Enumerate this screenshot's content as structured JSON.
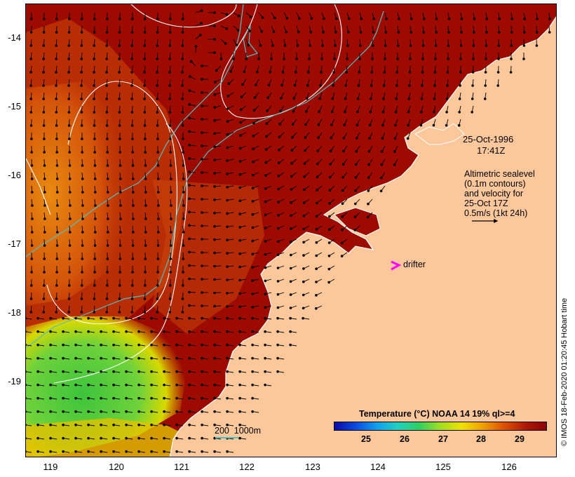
{
  "map": {
    "y_labels": [
      "-14",
      "-15",
      "-16",
      "-17",
      "-18",
      "-19"
    ],
    "x_labels": [
      "119",
      "120",
      "121",
      "122",
      "123",
      "124",
      "125",
      "126"
    ],
    "lon_range": [
      118.62,
      126.75
    ],
    "lat_range": [
      -13.52,
      -20.05
    ]
  },
  "annotations": {
    "date": "25-Oct-1996",
    "time": "17:41Z",
    "altimetry_lines": [
      "Altimetric sealevel",
      "(0.1m contours)",
      "and velocity for",
      "25-Oct 17Z"
    ],
    "velocity_scale": "0.5m/s (1kt 24h)",
    "drifter_label": "drifter",
    "depth_legend": "200  1000m"
  },
  "colorbar": {
    "title": "Temperature (°C) NOAA 14 19% ql>=4",
    "labels": [
      "25",
      "26",
      "27",
      "28",
      "29"
    ],
    "range": [
      24,
      29.7
    ]
  },
  "credit": "© IMOS 18-Feb-2020 01:20:45 Hobart time",
  "colors": {
    "land": "#fcc89b",
    "warm": "#9c0a00",
    "drifter": "#ff00ff",
    "isobath": "#50c0c0",
    "contour": "#ffffff"
  }
}
